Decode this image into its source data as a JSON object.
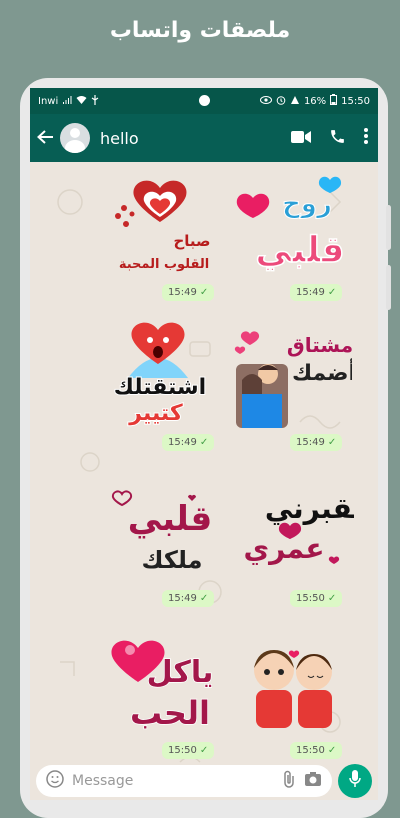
{
  "banner": {
    "title": "ملصقات واتساب"
  },
  "statusbar": {
    "carrier": "Inwi",
    "battery": "16%",
    "time": "15:50"
  },
  "appbar": {
    "contact_name": "hello"
  },
  "stickers": [
    {
      "text_lines": [
        "روح",
        "قلبي"
      ],
      "time": "15:49"
    },
    {
      "text_lines": [
        "صباح",
        "القلوب المحبة"
      ],
      "time": "15:49"
    },
    {
      "text_lines": [
        "مشتاق",
        "أضمك"
      ],
      "time": "15:49"
    },
    {
      "text_lines": [
        "اشتقتلك",
        "كتيير"
      ],
      "time": "15:49"
    },
    {
      "text_lines": [
        "تقبرني",
        "عمري"
      ],
      "time": "15:50"
    },
    {
      "text_lines": [
        "قلبي",
        "ملكك"
      ],
      "time": "15:49"
    },
    {
      "text_lines": [],
      "time": "15:50"
    },
    {
      "text_lines": [
        "ياكل",
        "الحب"
      ],
      "time": "15:50"
    }
  ],
  "input": {
    "placeholder": "Message"
  },
  "colors": {
    "header": "#075e54",
    "bubble": "#dcf8c6",
    "accent": "#00a884"
  }
}
